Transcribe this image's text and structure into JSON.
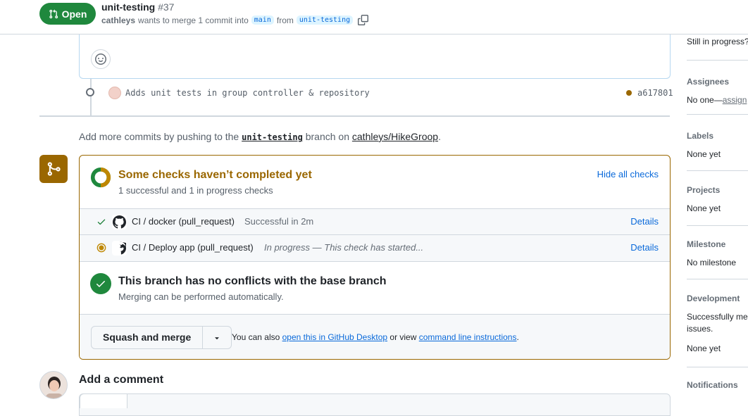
{
  "header": {
    "state": "Open",
    "title": "unit-testing",
    "number": "#37",
    "author": "cathleys",
    "meta_text": "wants to merge 1 commit into",
    "base_branch": "main",
    "from_text": "from",
    "head_branch": "unit-testing"
  },
  "commit": {
    "message": "Adds unit tests in group controller & repository",
    "sha": "a617801",
    "status_color": "#9a6700"
  },
  "push_hint": {
    "prefix": "Add more commits by pushing to the",
    "branch": "unit-testing",
    "middle": "branch on",
    "repo": "cathleys/HikeGroop",
    "suffix": "."
  },
  "checks": {
    "title": "Some checks haven’t completed yet",
    "subtitle": "1 successful and 1 in progress checks",
    "toggle": "Hide all checks",
    "items": [
      {
        "name": "CI / docker (pull_request)",
        "desc": "Successful in 2m",
        "details": "Details",
        "status": "success"
      },
      {
        "name": "CI / Deploy app (pull_request)",
        "desc": "In progress — This check has started...",
        "details": "Details",
        "status": "in_progress"
      }
    ]
  },
  "conflicts": {
    "title": "This branch has no conflicts with the base branch",
    "subtitle": "Merging can be performed automatically."
  },
  "merge": {
    "button": "Squash and merge",
    "also_text": "You can also",
    "desktop_link": "open this in GitHub Desktop",
    "or_view": "or view",
    "cli_link": "command line instructions",
    "period": "."
  },
  "comment": {
    "heading": "Add a comment"
  },
  "sidebar": {
    "top_text": "Still in progress?",
    "assignees": {
      "label": "Assignees",
      "value": "No one—",
      "link": "assign"
    },
    "labels": {
      "label": "Labels",
      "value": "None yet"
    },
    "projects": {
      "label": "Projects",
      "value": "None yet"
    },
    "milestone": {
      "label": "Milestone",
      "value": "No milestone"
    },
    "development": {
      "label": "Development",
      "line1": "Successfully mer",
      "line2": "issues.",
      "value": "None yet"
    },
    "notifications": {
      "label": "Notifications"
    }
  },
  "colors": {
    "open_green": "#1f883d",
    "pending": "#9a6700",
    "link": "#0969da"
  },
  "icons": [
    "git-pull-request-icon",
    "copy-icon",
    "smiley-icon",
    "git-commit-icon",
    "git-merge-icon",
    "check-icon",
    "dot-fill-icon",
    "github-mark-icon",
    "triangle-down-icon"
  ]
}
